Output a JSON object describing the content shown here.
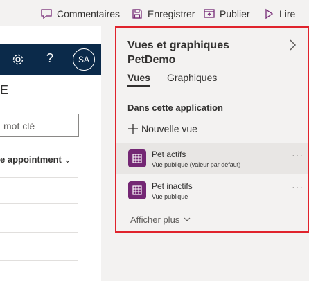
{
  "commandbar": {
    "comments": "Commentaires",
    "save": "Enregistrer",
    "publish": "Publier",
    "read": "Lire"
  },
  "app": {
    "help": "?",
    "avatar": "SA",
    "edge_char": "E",
    "search_placeholder": "mot clé",
    "view_selector": "e appointment"
  },
  "pane": {
    "title_line1": "Vues et graphiques",
    "title_line2": "PetDemo",
    "tabs": [
      {
        "label": "Vues",
        "selected": true
      },
      {
        "label": "Graphiques",
        "selected": false
      }
    ],
    "section_label": "Dans cette application",
    "new_view": "Nouvelle vue",
    "views": [
      {
        "name": "Pet actifs",
        "subtitle": "Vue publique (valeur par défaut)",
        "selected": true
      },
      {
        "name": "Pet inactifs",
        "subtitle": "Vue publique",
        "selected": false
      }
    ],
    "more_glyph": "···",
    "show_more": "Afficher plus"
  },
  "colors": {
    "highlight_border": "#e0232c",
    "app_header": "#0b2a4a",
    "view_icon": "#742774"
  }
}
